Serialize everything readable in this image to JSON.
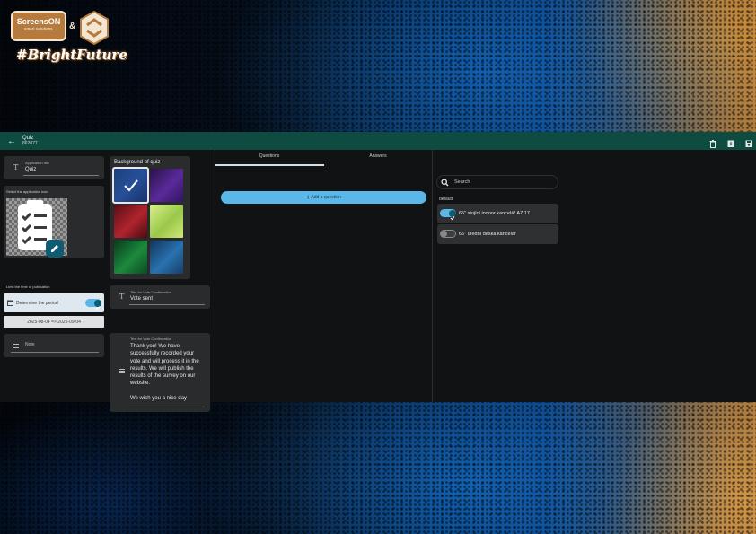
{
  "logo": {
    "brand_line1": "ScreensON",
    "brand_line2": "smart solutions",
    "ampersand": "&",
    "tagline": "#BrightFuture"
  },
  "topbar": {
    "title": "Quiz",
    "subtitle": "862077",
    "color": "#0e4b40"
  },
  "left": {
    "app_title_label": "Application title",
    "app_title_value": "Quiz",
    "icon_section_label": "Select the application icon",
    "limit_label": "Limit the time of publication",
    "determine_period": "Determine the period",
    "date_range": "2025-08-04 => 2025-09-04",
    "note_label": "Note"
  },
  "middle": {
    "background_label": "Background of quiz",
    "vote_title_label": "Title for Vote Confirmation",
    "vote_title_value": "Vote sent",
    "vote_text_label": "Text for Vote Confirmation",
    "vote_text_value": "Thank you! We have successfully recorded your vote and will process it in the results. We will publish the results of the survey on our website.",
    "vote_text_tail": "We wish you a nice day"
  },
  "tabs": {
    "questions": "Questions",
    "answers": "Answers"
  },
  "add_question": "Add a question",
  "devices": {
    "search_placeholder": "Search",
    "group": "default",
    "items": [
      {
        "label": "65\" stojící indoor kancelář AZ 17",
        "enabled": true
      },
      {
        "label": "65\" úřední deska kancelář",
        "enabled": false
      }
    ]
  },
  "colors": {
    "accent": "#5ab8e8",
    "card": "#2a2b2d",
    "panel": "#111214"
  }
}
